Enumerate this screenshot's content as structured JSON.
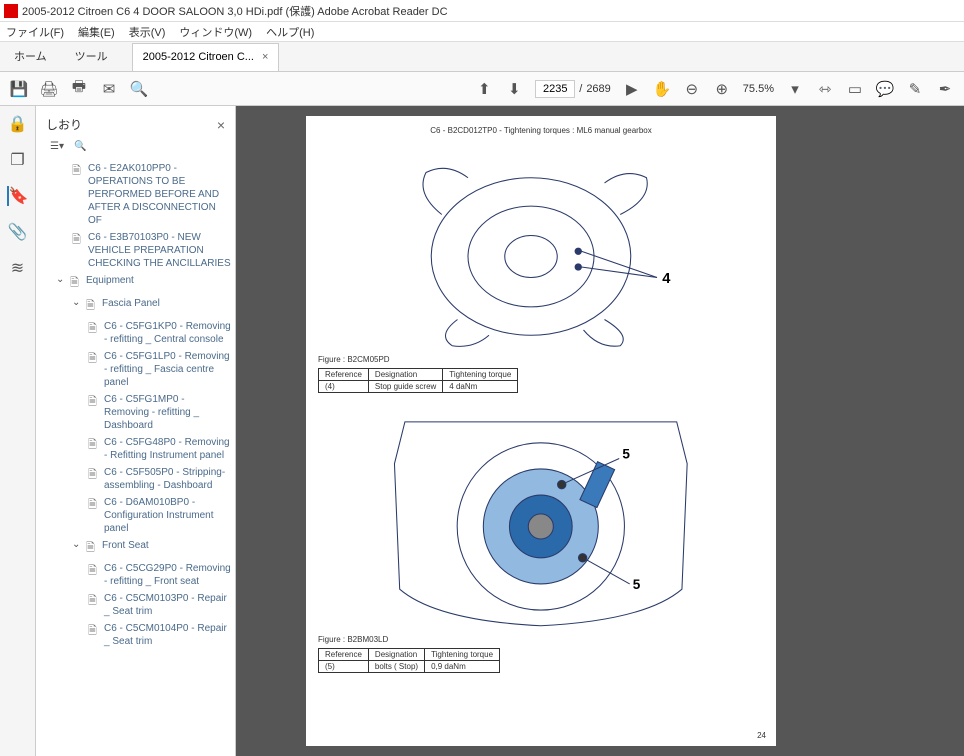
{
  "window": {
    "title": "2005-2012 Citroen C6 4 DOOR SALOON 3,0 HDi.pdf (保護)   Adobe Acrobat Reader DC"
  },
  "menu": {
    "file": "ファイル(F)",
    "edit": "編集(E)",
    "view": "表示(V)",
    "window": "ウィンドウ(W)",
    "help": "ヘルプ(H)"
  },
  "tabs": {
    "home": "ホーム",
    "tool": "ツール",
    "doc": "2005-2012 Citroen C...",
    "close": "×"
  },
  "toolbar": {
    "page_current": "2235",
    "page_sep": "/",
    "page_total": "2689",
    "zoom": "75.5%"
  },
  "nav": {
    "header": "しおり",
    "close": "×",
    "nodes": {
      "n0": "C6 - E2AK010PP0 - OPERATIONS TO BE PERFORMED BEFORE AND AFTER A DISCONNECTION OF",
      "n1": "C6 - E3B70103P0 - NEW VEHICLE PREPARATION CHECKING THE ANCILLARIES",
      "n2": "Equipment",
      "n3": "Fascia Panel",
      "n4": "C6 - C5FG1KP0 - Removing - refitting _ Central console",
      "n5": "C6 - C5FG1LP0 - Removing - refitting _ Fascia centre panel",
      "n6": "C6 - C5FG1MP0 - Removing - refitting _ Dashboard",
      "n7": "C6 - C5FG48P0 - Removing - Refitting Instrument panel",
      "n8": "C6 - C5F505P0 - Stripping-assembling - Dashboard",
      "n9": "C6 - D6AM010BP0 - Configuration Instrument panel",
      "n10": "Front Seat",
      "n11": "C6 - C5CG29P0 - Removing - refitting _ Front seat",
      "n12": "C6 - C5CM0103P0 - Repair _ Seat trim",
      "n13": "C6 - C5CM0104P0 - Repair _ Seat trim"
    }
  },
  "doc": {
    "page_title": "C6 - B2CD012TP0 - Tightening torques : ML6 manual gearbox",
    "fig1_label": "Figure : B2CM05PD",
    "fig2_label": "Figure : B2BM03LD",
    "callout_4": "4",
    "callout_5a": "5",
    "callout_5b": "5",
    "page_num": "24",
    "table1": {
      "h1": "Reference",
      "h2": "Designation",
      "h3": "Tightening torque",
      "r1c1": "(4)",
      "r1c2": "Stop guide screw",
      "r1c3": "4 daNm"
    },
    "table2": {
      "h1": "Reference",
      "h2": "Designation",
      "h3": "Tightening torque",
      "r1c1": "(5)",
      "r1c2": "bolts ( Stop)",
      "r1c3": "0,9 daNm"
    }
  }
}
